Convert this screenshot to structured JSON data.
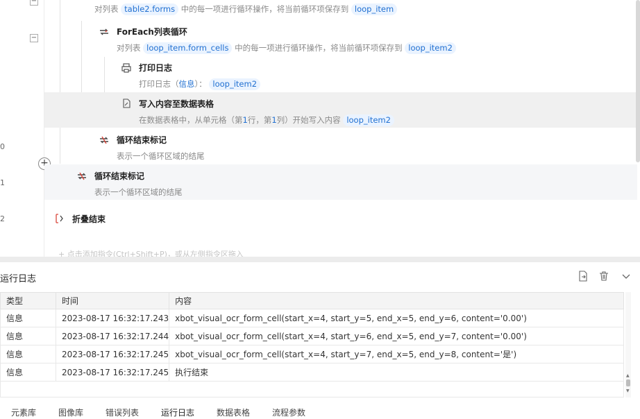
{
  "line_numbers": [
    "0",
    "1",
    "2"
  ],
  "flow": {
    "block0": {
      "desc_prefix": "对列表",
      "chip1": "table2.forms",
      "desc_mid": "中的每一项进行循环操作，将当前循环项保存到",
      "chip2": "loop_item"
    },
    "block1": {
      "title": "ForEach列表循环",
      "desc_prefix": "对列表",
      "chip1": "loop_item.form_cells",
      "desc_mid": "中的每一项进行循环操作，将当前循环项保存到",
      "chip2": "loop_item2"
    },
    "block2": {
      "title": "打印日志",
      "desc_prefix": "打印日志（",
      "level": "信息",
      "desc_mid": "）：",
      "chip": "loop_item2"
    },
    "block3": {
      "title": "写入内容至数据表格",
      "desc_a": "在数据表格中，从单元格（第",
      "n1": "1",
      "desc_b": "行，第",
      "n2": "1",
      "desc_c": "列）开始写入内容",
      "chip": "loop_item2"
    },
    "block4": {
      "title": "循环结束标记",
      "desc": "表示一个循环区域的结尾"
    },
    "block5": {
      "title": "循环结束标记",
      "desc": "表示一个循环区域的结尾"
    },
    "block6": {
      "title": "折叠结束"
    },
    "hint": "+ 点击添加指令(Ctrl+Shift+P)，或从左侧指令区拖入"
  },
  "log": {
    "title": "运行日志",
    "columns": [
      "类型",
      "时间",
      "内容"
    ],
    "rows": [
      [
        "信息",
        "2023-08-17 16:32:17.243",
        "xbot_visual_ocr_form_cell(start_x=4, start_y=5, end_x=5, end_y=6, content='0.00')"
      ],
      [
        "信息",
        "2023-08-17 16:32:17.244",
        "xbot_visual_ocr_form_cell(start_x=4, start_y=6, end_x=5, end_y=7, content='0.00')"
      ],
      [
        "信息",
        "2023-08-17 16:32:17.245",
        "xbot_visual_ocr_form_cell(start_x=4, start_y=7, end_x=5, end_y=8, content='是')"
      ],
      [
        "信息",
        "2023-08-17 16:32:17.245",
        "执行结束"
      ]
    ],
    "icons": [
      "export-icon",
      "trash-icon",
      "chevron-down-icon"
    ]
  },
  "tabs": [
    "元素库",
    "图像库",
    "错误列表",
    "运行日志",
    "数据表格",
    "流程参数"
  ],
  "active_tab": "运行日志",
  "colors": {
    "chip_bg": "#eaf3ff",
    "chip_text": "#1f6fd1",
    "loop_icon_red": "#d9463a",
    "highlight_row": "#f0f0f0"
  }
}
